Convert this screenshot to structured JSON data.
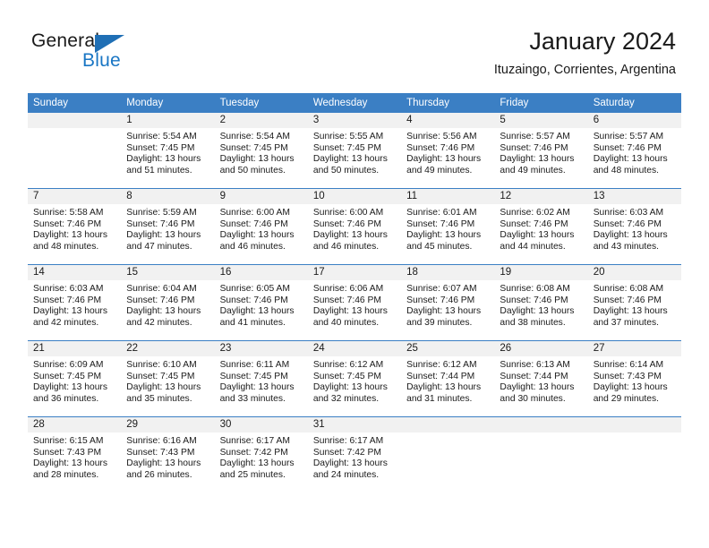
{
  "brand": {
    "word_one": "General",
    "word_two": "Blue",
    "flag_icon": "triangle-flag-icon"
  },
  "header": {
    "title": "January 2024",
    "subtitle": "Ituzaingo, Corrientes, Argentina"
  },
  "colors": {
    "header_blue": "#3b7fc4",
    "brand_blue": "#1976c4",
    "daynum_bg": "#f1f1f1",
    "text": "#1a1a1a"
  },
  "calendar": {
    "weekday_headers": [
      "Sunday",
      "Monday",
      "Tuesday",
      "Wednesday",
      "Thursday",
      "Friday",
      "Saturday"
    ],
    "weeks": [
      [
        {
          "day": "",
          "lines": []
        },
        {
          "day": "1",
          "lines": [
            "Sunrise: 5:54 AM",
            "Sunset: 7:45 PM",
            "Daylight: 13 hours",
            "and 51 minutes."
          ]
        },
        {
          "day": "2",
          "lines": [
            "Sunrise: 5:54 AM",
            "Sunset: 7:45 PM",
            "Daylight: 13 hours",
            "and 50 minutes."
          ]
        },
        {
          "day": "3",
          "lines": [
            "Sunrise: 5:55 AM",
            "Sunset: 7:45 PM",
            "Daylight: 13 hours",
            "and 50 minutes."
          ]
        },
        {
          "day": "4",
          "lines": [
            "Sunrise: 5:56 AM",
            "Sunset: 7:46 PM",
            "Daylight: 13 hours",
            "and 49 minutes."
          ]
        },
        {
          "day": "5",
          "lines": [
            "Sunrise: 5:57 AM",
            "Sunset: 7:46 PM",
            "Daylight: 13 hours",
            "and 49 minutes."
          ]
        },
        {
          "day": "6",
          "lines": [
            "Sunrise: 5:57 AM",
            "Sunset: 7:46 PM",
            "Daylight: 13 hours",
            "and 48 minutes."
          ]
        }
      ],
      [
        {
          "day": "7",
          "lines": [
            "Sunrise: 5:58 AM",
            "Sunset: 7:46 PM",
            "Daylight: 13 hours",
            "and 48 minutes."
          ]
        },
        {
          "day": "8",
          "lines": [
            "Sunrise: 5:59 AM",
            "Sunset: 7:46 PM",
            "Daylight: 13 hours",
            "and 47 minutes."
          ]
        },
        {
          "day": "9",
          "lines": [
            "Sunrise: 6:00 AM",
            "Sunset: 7:46 PM",
            "Daylight: 13 hours",
            "and 46 minutes."
          ]
        },
        {
          "day": "10",
          "lines": [
            "Sunrise: 6:00 AM",
            "Sunset: 7:46 PM",
            "Daylight: 13 hours",
            "and 46 minutes."
          ]
        },
        {
          "day": "11",
          "lines": [
            "Sunrise: 6:01 AM",
            "Sunset: 7:46 PM",
            "Daylight: 13 hours",
            "and 45 minutes."
          ]
        },
        {
          "day": "12",
          "lines": [
            "Sunrise: 6:02 AM",
            "Sunset: 7:46 PM",
            "Daylight: 13 hours",
            "and 44 minutes."
          ]
        },
        {
          "day": "13",
          "lines": [
            "Sunrise: 6:03 AM",
            "Sunset: 7:46 PM",
            "Daylight: 13 hours",
            "and 43 minutes."
          ]
        }
      ],
      [
        {
          "day": "14",
          "lines": [
            "Sunrise: 6:03 AM",
            "Sunset: 7:46 PM",
            "Daylight: 13 hours",
            "and 42 minutes."
          ]
        },
        {
          "day": "15",
          "lines": [
            "Sunrise: 6:04 AM",
            "Sunset: 7:46 PM",
            "Daylight: 13 hours",
            "and 42 minutes."
          ]
        },
        {
          "day": "16",
          "lines": [
            "Sunrise: 6:05 AM",
            "Sunset: 7:46 PM",
            "Daylight: 13 hours",
            "and 41 minutes."
          ]
        },
        {
          "day": "17",
          "lines": [
            "Sunrise: 6:06 AM",
            "Sunset: 7:46 PM",
            "Daylight: 13 hours",
            "and 40 minutes."
          ]
        },
        {
          "day": "18",
          "lines": [
            "Sunrise: 6:07 AM",
            "Sunset: 7:46 PM",
            "Daylight: 13 hours",
            "and 39 minutes."
          ]
        },
        {
          "day": "19",
          "lines": [
            "Sunrise: 6:08 AM",
            "Sunset: 7:46 PM",
            "Daylight: 13 hours",
            "and 38 minutes."
          ]
        },
        {
          "day": "20",
          "lines": [
            "Sunrise: 6:08 AM",
            "Sunset: 7:46 PM",
            "Daylight: 13 hours",
            "and 37 minutes."
          ]
        }
      ],
      [
        {
          "day": "21",
          "lines": [
            "Sunrise: 6:09 AM",
            "Sunset: 7:45 PM",
            "Daylight: 13 hours",
            "and 36 minutes."
          ]
        },
        {
          "day": "22",
          "lines": [
            "Sunrise: 6:10 AM",
            "Sunset: 7:45 PM",
            "Daylight: 13 hours",
            "and 35 minutes."
          ]
        },
        {
          "day": "23",
          "lines": [
            "Sunrise: 6:11 AM",
            "Sunset: 7:45 PM",
            "Daylight: 13 hours",
            "and 33 minutes."
          ]
        },
        {
          "day": "24",
          "lines": [
            "Sunrise: 6:12 AM",
            "Sunset: 7:45 PM",
            "Daylight: 13 hours",
            "and 32 minutes."
          ]
        },
        {
          "day": "25",
          "lines": [
            "Sunrise: 6:12 AM",
            "Sunset: 7:44 PM",
            "Daylight: 13 hours",
            "and 31 minutes."
          ]
        },
        {
          "day": "26",
          "lines": [
            "Sunrise: 6:13 AM",
            "Sunset: 7:44 PM",
            "Daylight: 13 hours",
            "and 30 minutes."
          ]
        },
        {
          "day": "27",
          "lines": [
            "Sunrise: 6:14 AM",
            "Sunset: 7:43 PM",
            "Daylight: 13 hours",
            "and 29 minutes."
          ]
        }
      ],
      [
        {
          "day": "28",
          "lines": [
            "Sunrise: 6:15 AM",
            "Sunset: 7:43 PM",
            "Daylight: 13 hours",
            "and 28 minutes."
          ]
        },
        {
          "day": "29",
          "lines": [
            "Sunrise: 6:16 AM",
            "Sunset: 7:43 PM",
            "Daylight: 13 hours",
            "and 26 minutes."
          ]
        },
        {
          "day": "30",
          "lines": [
            "Sunrise: 6:17 AM",
            "Sunset: 7:42 PM",
            "Daylight: 13 hours",
            "and 25 minutes."
          ]
        },
        {
          "day": "31",
          "lines": [
            "Sunrise: 6:17 AM",
            "Sunset: 7:42 PM",
            "Daylight: 13 hours",
            "and 24 minutes."
          ]
        },
        {
          "day": "",
          "lines": []
        },
        {
          "day": "",
          "lines": []
        },
        {
          "day": "",
          "lines": []
        }
      ]
    ]
  }
}
